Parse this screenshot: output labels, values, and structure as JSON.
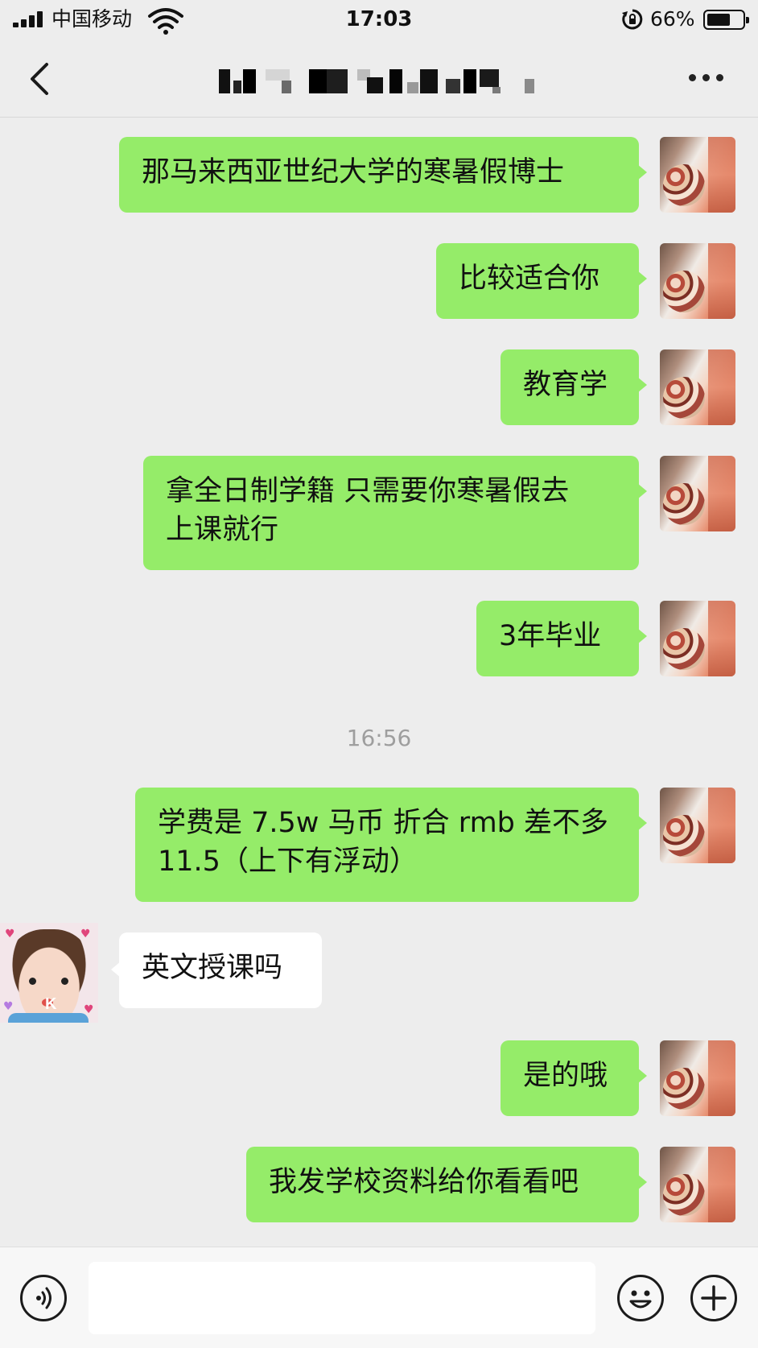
{
  "status_bar": {
    "carrier": "中国移动",
    "time": "17:03",
    "battery_percent": "66%",
    "battery_level": 0.66,
    "icons": [
      "signal-icon",
      "wifi-icon",
      "orientation-lock-icon",
      "battery-icon"
    ]
  },
  "nav": {
    "back_icon": "chevron-left-icon",
    "title_obscured": true,
    "more_icon": "more-dots-icon"
  },
  "messages": [
    {
      "side": "out",
      "text": "那马来西亚世纪大学的寒暑假博士"
    },
    {
      "side": "out",
      "text": "比较适合你"
    },
    {
      "side": "out",
      "text": "教育学"
    },
    {
      "side": "out",
      "text": "拿全日制学籍 只需要你寒暑假去\n上课就行"
    },
    {
      "side": "out",
      "text": "3年毕业"
    },
    {
      "side": "out",
      "text": "学费是 7.5w 马币 折合 rmb 差不多\n11.5（上下有浮动）"
    },
    {
      "side": "in",
      "text": "英文授课吗"
    },
    {
      "side": "out",
      "text": "是的哦"
    },
    {
      "side": "out",
      "text": "我发学校资料给你看看吧"
    }
  ],
  "time_divider": "16:56",
  "input_bar": {
    "value": "",
    "icons": [
      "voice-icon",
      "emoji-icon",
      "plus-icon"
    ]
  },
  "colors": {
    "background": "#ededed",
    "bubble_out": "#95ec69",
    "bubble_in": "#ffffff"
  }
}
